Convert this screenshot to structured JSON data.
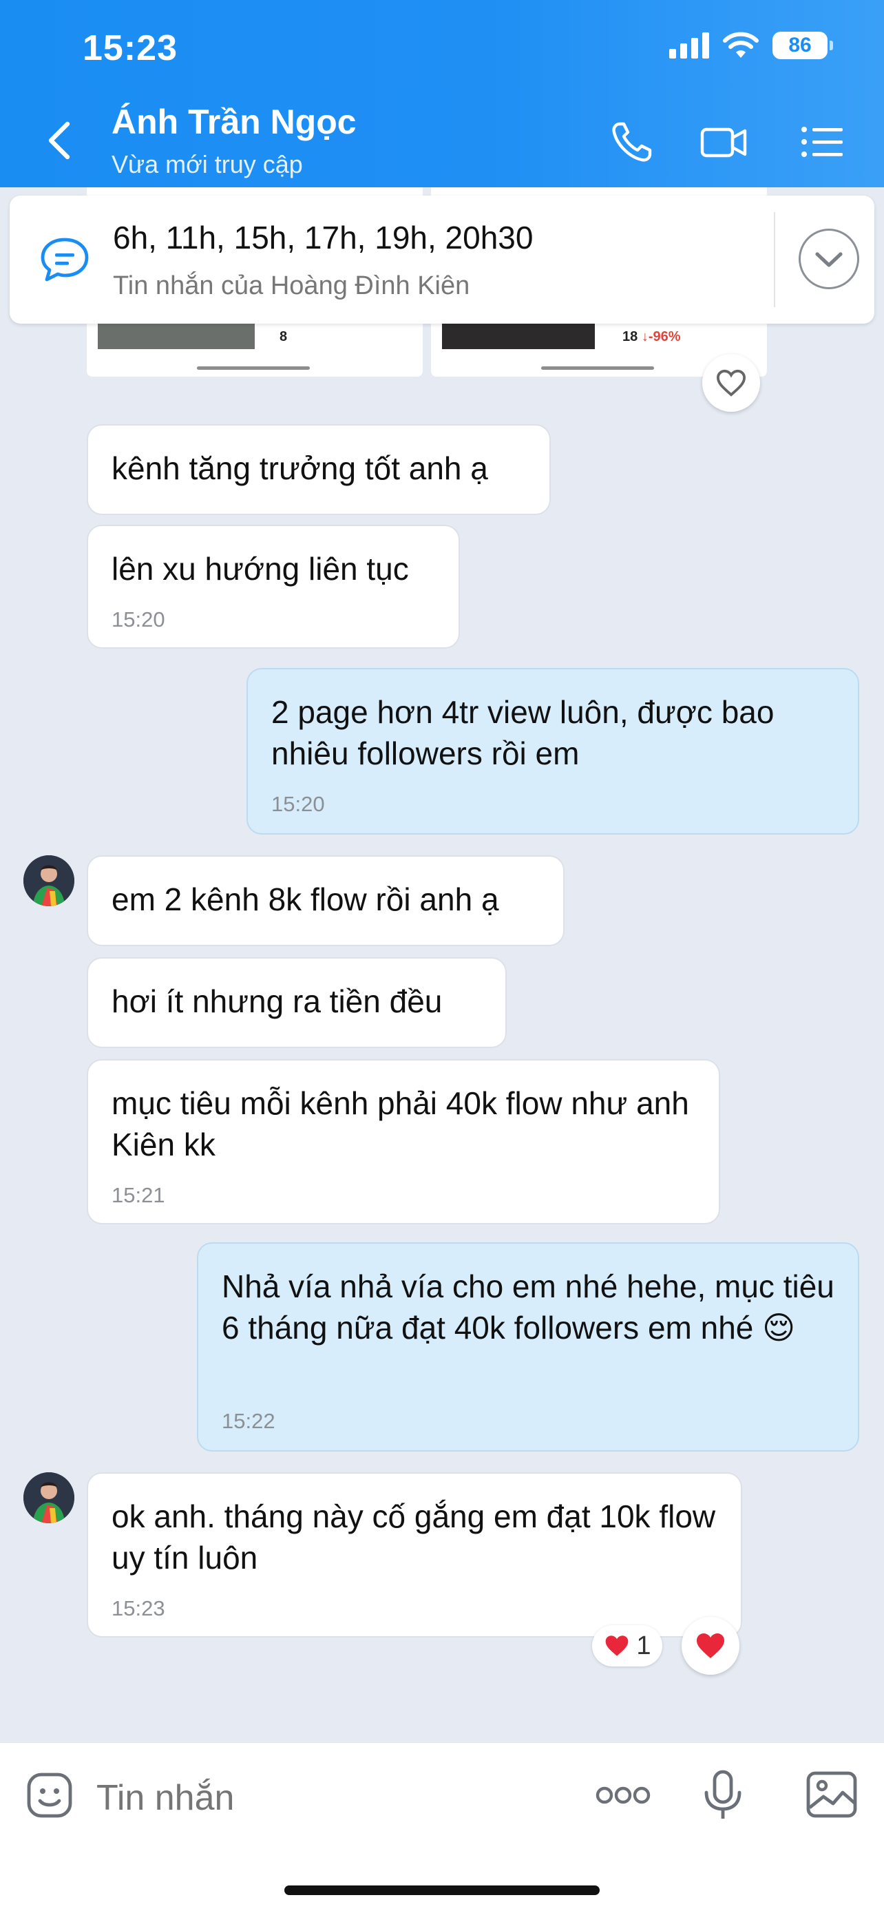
{
  "status_bar": {
    "time": "15:23",
    "battery": "86"
  },
  "header": {
    "contact_name": "Ánh Trần Ngọc",
    "contact_status": "Vừa mới truy cập"
  },
  "shared_preview": {
    "left_value": "8",
    "right_value": "18",
    "right_change": "↓-96%"
  },
  "pinned": {
    "title": "6h, 11h, 15h, 17h, 19h, 20h30",
    "subtitle": "Tin nhắn của Hoàng Đình Kiên"
  },
  "messages": [
    {
      "text": "kênh tăng trưởng tốt anh ạ",
      "time": ""
    },
    {
      "text": "lên xu hướng liên tục",
      "time": "15:20"
    },
    {
      "text": "2 page hơn 4tr view luôn, được bao nhiêu followers rồi em",
      "time": "15:20"
    },
    {
      "text": "em 2 kênh 8k flow rồi anh ạ",
      "time": ""
    },
    {
      "text": "hơi ít nhưng ra  tiền đều",
      "time": ""
    },
    {
      "text": "mục tiêu mỗi kênh phải 40k flow như anh Kiên kk",
      "time": "15:21"
    },
    {
      "text": "Nhả vía nhả vía cho em nhé hehe, mục tiêu 6 tháng nữa đạt 40k followers em nhé",
      "emoji": "😌",
      "time": "15:22"
    },
    {
      "text": "ok anh. tháng này cố gắng em đạt 10k flow uy tín luôn",
      "time": "15:23"
    }
  ],
  "reaction": {
    "count": "1"
  },
  "composer": {
    "placeholder": "Tin nhắn"
  },
  "colors": {
    "header": "#1a8df3",
    "outgoing": "#d7edfc",
    "incoming": "#ffffff",
    "heart": "#e8283a"
  }
}
